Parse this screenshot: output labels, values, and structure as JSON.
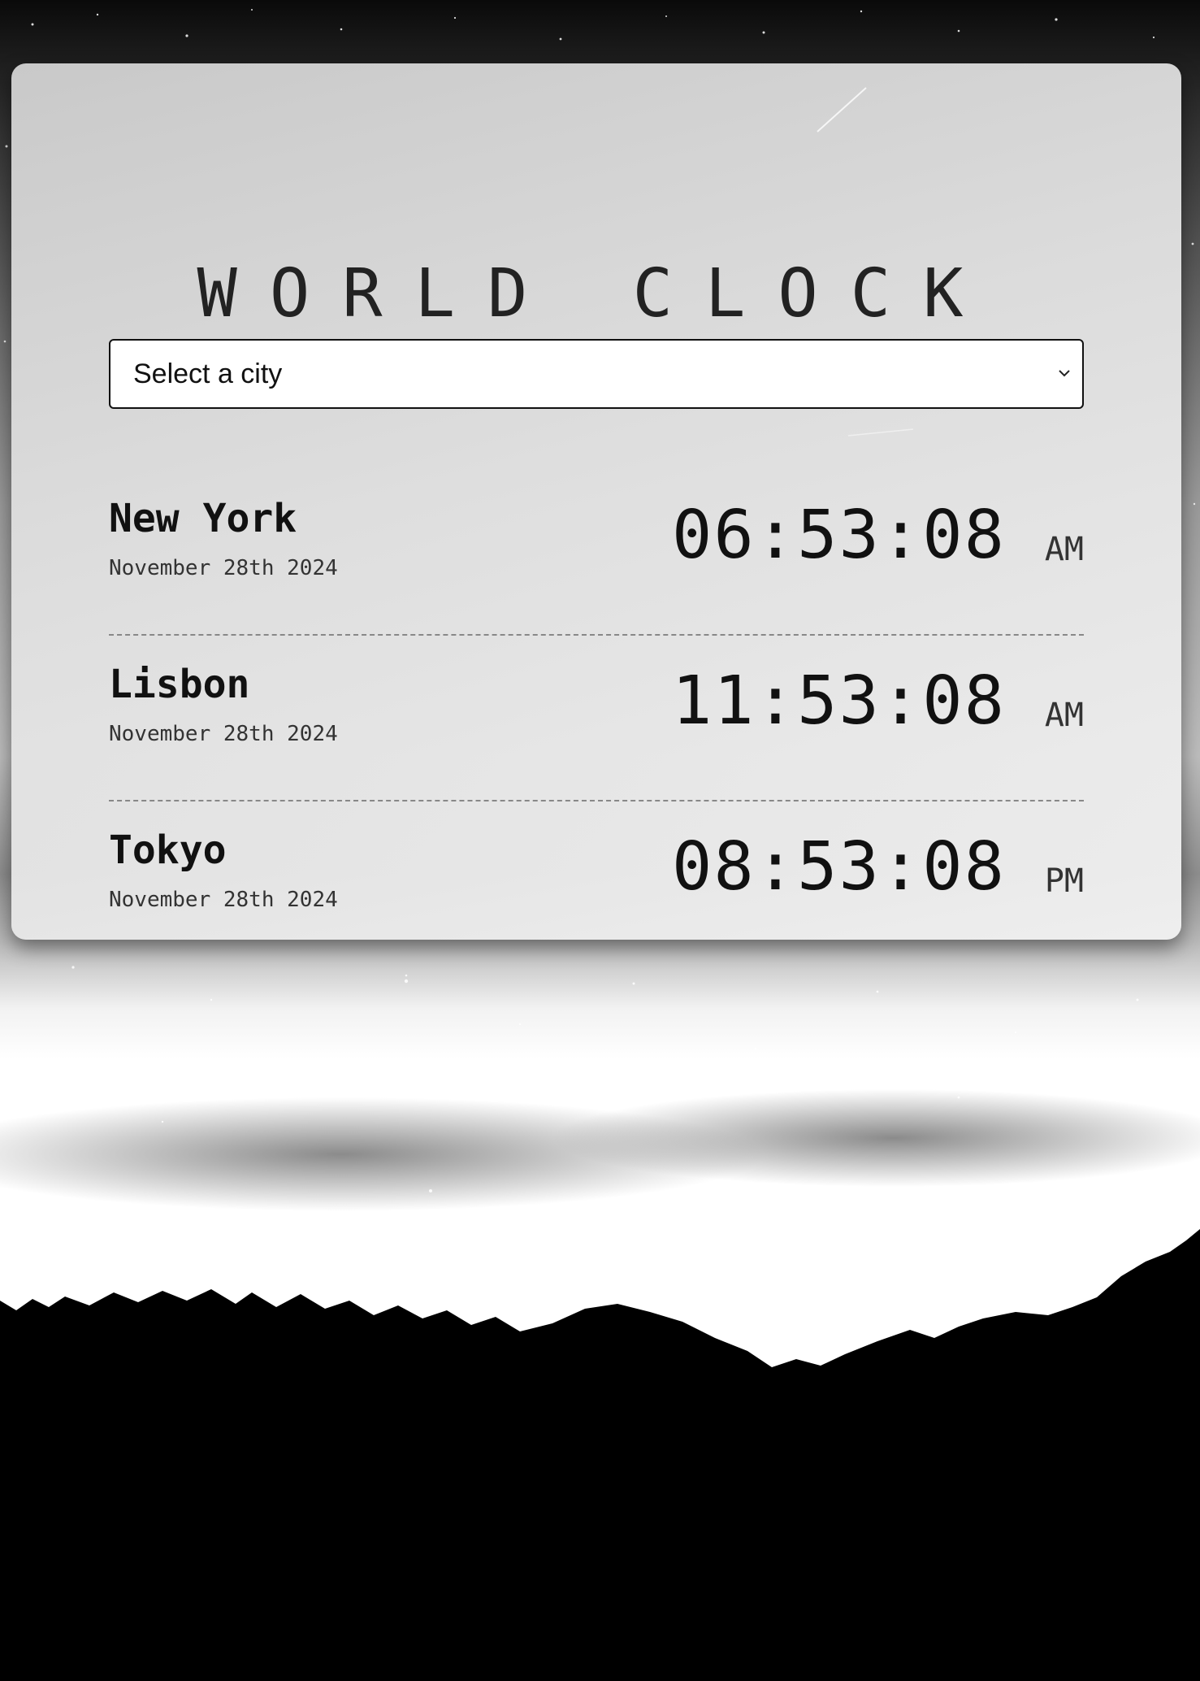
{
  "app": {
    "title": "WORLD CLOCK"
  },
  "city_select": {
    "selected_label": "Select a city",
    "icon": "chevron-down-icon"
  },
  "cities": [
    {
      "name": "New York",
      "date": "November 28th 2024",
      "time": "06:53:08",
      "ampm": "AM"
    },
    {
      "name": "Lisbon",
      "date": "November 28th 2024",
      "time": "11:53:08",
      "ampm": "AM"
    },
    {
      "name": "Tokyo",
      "date": "November 28th 2024",
      "time": "08:53:08",
      "ampm": "PM"
    }
  ],
  "colors": {
    "page_background": "#000000",
    "card_background": "#e0e0e0",
    "text": "#111111",
    "divider": "#888888"
  }
}
